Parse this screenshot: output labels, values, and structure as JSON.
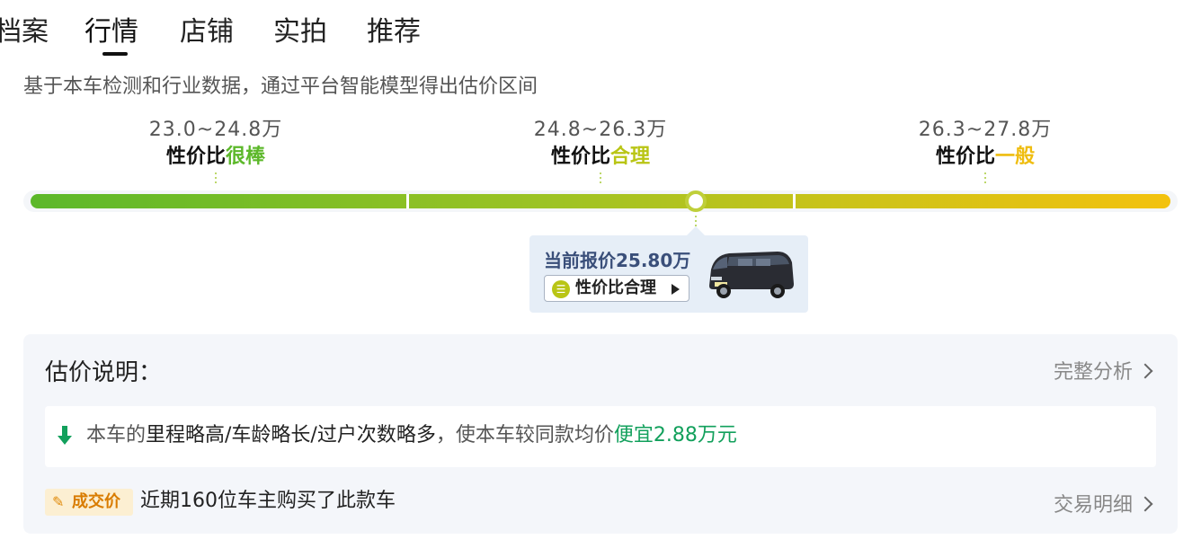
{
  "tabs": [
    "档案",
    "行情",
    "店铺",
    "实拍",
    "推荐"
  ],
  "active_tab": "行情",
  "subtitle": "基于本车检测和行业数据，通过平台智能模型得出估价区间",
  "ranges": [
    {
      "price": "23.0~24.8万",
      "label_prefix": "性价比",
      "label_value": "很棒",
      "color": "#5cb82a"
    },
    {
      "price": "24.8~26.3万",
      "label_prefix": "性价比",
      "label_value": "合理",
      "color": "#b9c515"
    },
    {
      "price": "26.3~27.8万",
      "label_prefix": "性价比",
      "label_value": "一般",
      "color": "#efbd10"
    }
  ],
  "current": {
    "title": "当前报价25.80万",
    "badge_label": "性价比合理",
    "value": 25.8,
    "scale_min": 23.0,
    "scale_max": 27.8
  },
  "explain": {
    "title": "估价说明：",
    "link": "完整分析",
    "note_prefix": "本车的",
    "note_factors": "里程略高/车龄略长/过户次数略多",
    "note_middle": "，使本车较同款均价",
    "note_result": "便宜2.88万元"
  },
  "deal": {
    "badge": "成交价",
    "text": "近期160位车主购买了此款车",
    "link": "交易明细"
  },
  "colors": {
    "good": "#5cb82a",
    "fair": "#b9c515",
    "average": "#efbd10",
    "cheaper": "#12a05c"
  }
}
